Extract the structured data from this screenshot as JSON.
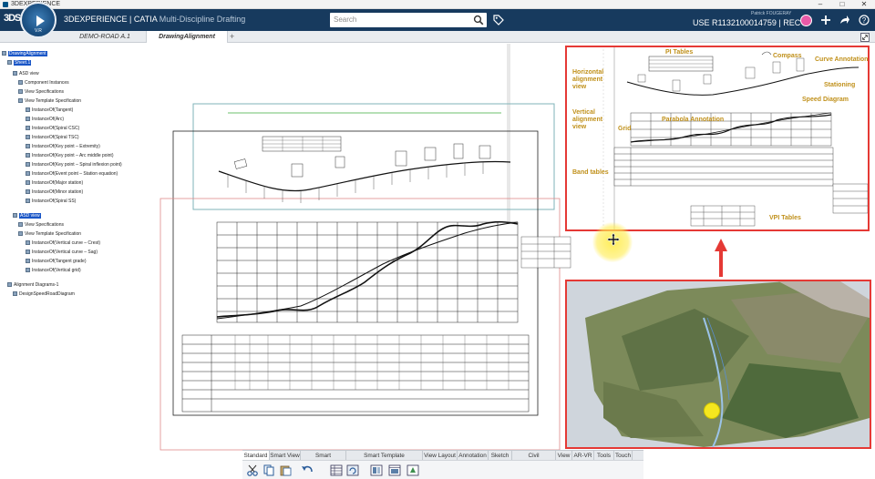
{
  "os": {
    "title": "3DEXPERIENCE"
  },
  "header": {
    "compass_version": "V.R",
    "brand": "3DEXPERIENCE | CATIA",
    "app": "Multi-Discipline Drafting",
    "search_placeholder": "Search",
    "user_name": "Patrick FOUGERAY",
    "user_context": "USE R1132100014759 | REC ⌄"
  },
  "tabs": [
    {
      "label": "DEMO-ROAD A.1",
      "active": false
    },
    {
      "label": "DrawingAlignment",
      "active": true
    }
  ],
  "tree": {
    "items": [
      {
        "label": "DrawingAlignment",
        "selected": true
      },
      {
        "label": "Sheet.1",
        "selected": true
      },
      {
        "label": "ASD view",
        "selected": false
      },
      {
        "label": "Component Instances",
        "selected": false
      },
      {
        "label": "View Specifications",
        "selected": false
      },
      {
        "label": "View Template Specification",
        "selected": false
      },
      {
        "label": "InstanceOf(Tangent)",
        "selected": false
      },
      {
        "label": "InstanceOf(Arc)",
        "selected": false
      },
      {
        "label": "InstanceOf(Spiral CSC)",
        "selected": false
      },
      {
        "label": "InstanceOf(Spiral TSC)",
        "selected": false
      },
      {
        "label": "InstanceOf(Key point – Extremity)",
        "selected": false
      },
      {
        "label": "InstanceOf(Key point – Arc middle point)",
        "selected": false
      },
      {
        "label": "InstanceOf(Key point – Spiral inflexion point)",
        "selected": false
      },
      {
        "label": "InstanceOf(Event point – Station equation)",
        "selected": false
      },
      {
        "label": "InstanceOf(Major station)",
        "selected": false
      },
      {
        "label": "InstanceOf(Minor station)",
        "selected": false
      },
      {
        "label": "InstanceOf(Spiral SS)",
        "selected": false
      },
      {
        "label": "ASD view",
        "selected": true
      },
      {
        "label": "View Specifications",
        "selected": false
      },
      {
        "label": "View Template Specification",
        "selected": false
      },
      {
        "label": "InstanceOf(Vertical curve – Crest)",
        "selected": false
      },
      {
        "label": "InstanceOf(Vertical curve – Sag)",
        "selected": false
      },
      {
        "label": "InstanceOf(Tangent grade)",
        "selected": false
      },
      {
        "label": "InstanceOf(Vertical grid)",
        "selected": false
      },
      {
        "label": "Alignment Diagrams-1",
        "selected": false
      },
      {
        "label": "DesignSpeedRoadDiagram",
        "selected": false
      }
    ]
  },
  "annotations": {
    "pi_tables": "PI Tables",
    "compass": "Compass",
    "curve_annotation": "Curve Annotation",
    "horizontal_view": "Horizontal alignment view",
    "stationing": "Stationing",
    "speed_diagram": "Speed Diagram",
    "vertical_view": "Vertical alignment view",
    "grid": "Grid",
    "parabola_annotation": "Parabola Annotation",
    "band_tables": "Band tables",
    "vpi_tables": "VPI Tables"
  },
  "action_bar": {
    "tabs": [
      {
        "label": "Standard",
        "active": true
      },
      {
        "label": "Smart View",
        "active": false
      },
      {
        "label": "Smart Annotation",
        "active": false
      },
      {
        "label": "Smart Template Management",
        "active": false
      },
      {
        "label": "View Layout",
        "active": false
      },
      {
        "label": "Annotation",
        "active": false
      },
      {
        "label": "Sketch",
        "active": false
      },
      {
        "label": "Civil Engineering",
        "active": false
      },
      {
        "label": "View",
        "active": false
      },
      {
        "label": "AR-VR",
        "active": false
      },
      {
        "label": "Tools",
        "active": false
      },
      {
        "label": "Touch",
        "active": false
      }
    ],
    "tools": [
      "cut-icon",
      "copy-icon",
      "paste-icon",
      "undo-icon",
      "table-icon",
      "refresh-icon",
      "layout-icon",
      "view-icon",
      "update-icon"
    ]
  },
  "colors": {
    "header": "#173a5e",
    "accent_red": "#e53935",
    "annotation": "#c0901a",
    "selection": "#1a56c7"
  }
}
